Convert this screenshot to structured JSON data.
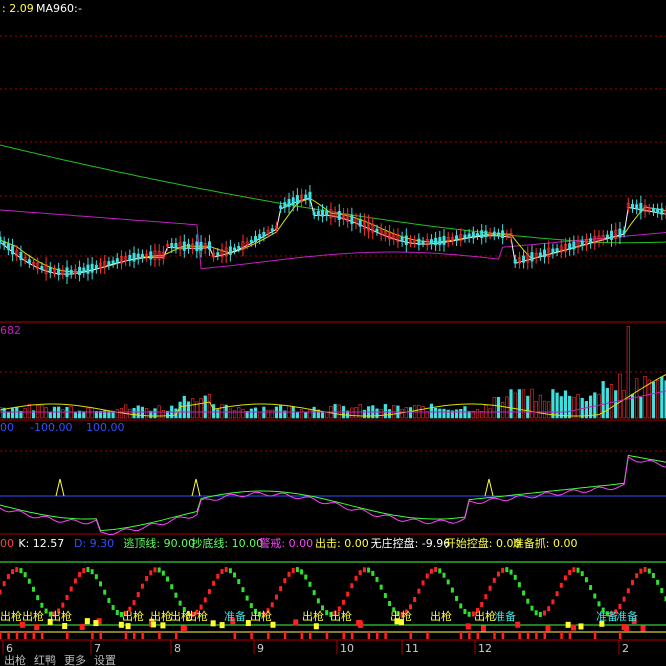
{
  "header": {
    "ma_value": ": 2.09",
    "ma960_label": "MA960:",
    "ma960_value": "-"
  },
  "volume_panel": {
    "value_label": "682"
  },
  "indicator_panel": {
    "labels": [
      "00",
      "-100.00",
      "100.00"
    ]
  },
  "kdj_panel": {
    "items": [
      {
        "text": "00",
        "color": "#ff4040"
      },
      {
        "text": "K: 12.57",
        "color": "#ffffff"
      },
      {
        "text": "D: 9.30",
        "color": "#3050ff"
      },
      {
        "text": "逃顶线: 90.00",
        "color": "#60ff60"
      },
      {
        "text": "抄底线: 10.00",
        "color": "#60ff60"
      },
      {
        "text": "警戒: 0.00",
        "color": "#ff40ff"
      },
      {
        "text": "出击: 0.00",
        "color": "#ffff40"
      },
      {
        "text": "无庄控盘: -9.96",
        "color": "#ffffff"
      },
      {
        "text": "开始控盘: 0.00",
        "color": "#ffff40"
      },
      {
        "text": "准备抓: 0.00",
        "color": "#ffff40"
      }
    ],
    "signals": [
      {
        "text": "出枪",
        "color": "#ffff40"
      },
      {
        "text": "出枪",
        "color": "#ffff40"
      },
      {
        "text": "出枪",
        "color": "#ffff40"
      },
      {
        "text": "出枪",
        "color": "#ffff40"
      },
      {
        "text": "出枪",
        "color": "#ffff40"
      },
      {
        "text": "出枪",
        "color": "#ffff40"
      },
      {
        "text": "出枪",
        "color": "#ffff40"
      },
      {
        "text": "准备",
        "color": "#40e0e0"
      },
      {
        "text": "出枪",
        "color": "#ffff40"
      },
      {
        "text": "出枪",
        "color": "#ffff40"
      },
      {
        "text": "出枪",
        "color": "#ffff40"
      },
      {
        "text": "出枪",
        "color": "#ffff40"
      },
      {
        "text": "出枪",
        "color": "#ffff40"
      },
      {
        "text": "出枪",
        "color": "#ffff40"
      },
      {
        "text": "准备",
        "color": "#40e0e0"
      },
      {
        "text": "准备",
        "color": "#40e0e0"
      },
      {
        "text": "准备",
        "color": "#40e0e0"
      }
    ]
  },
  "axis": {
    "dates": [
      "6",
      "7",
      "8",
      "9",
      "10",
      "11",
      "12",
      "2"
    ]
  },
  "tabs": [
    "出枪",
    "红鸭",
    "更多",
    "设置"
  ],
  "colors": {
    "grid": "#b00000",
    "green_ma": "#20c020",
    "magenta_ma": "#c020c0",
    "yellow_ma": "#e0e000",
    "candle_up": "#ff3030",
    "candle_down": "#40e0e0"
  },
  "chart_data": {
    "type": "candlestick",
    "note_panels": [
      "price",
      "volume",
      "indicator",
      "kdj"
    ]
  }
}
